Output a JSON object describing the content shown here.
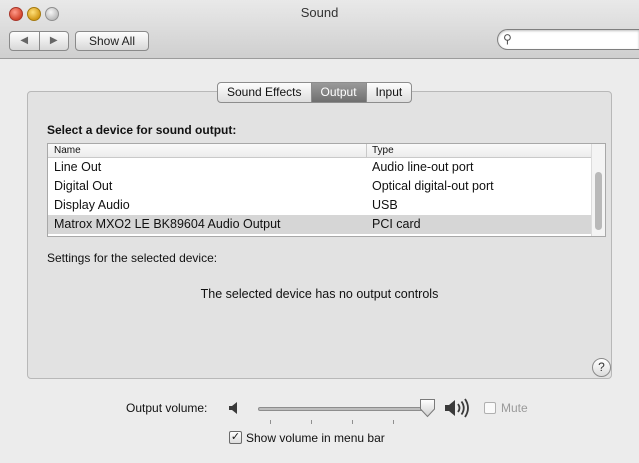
{
  "window": {
    "title": "Sound"
  },
  "toolbar": {
    "back_icon": "triangle-left-icon",
    "forward_icon": "triangle-right-icon",
    "show_all_label": "Show All",
    "search_value": "",
    "search_icon": "magnifier-icon"
  },
  "tabs": [
    {
      "label": "Sound Effects",
      "active": false
    },
    {
      "label": "Output",
      "active": true
    },
    {
      "label": "Input",
      "active": false
    }
  ],
  "output": {
    "section_title": "Select a device for sound output:",
    "columns": {
      "name": "Name",
      "type": "Type"
    },
    "devices": [
      {
        "name": "Line Out",
        "type": "Audio line-out port",
        "selected": false
      },
      {
        "name": "Digital Out",
        "type": "Optical digital-out port",
        "selected": false
      },
      {
        "name": "Display Audio",
        "type": "USB",
        "selected": false
      },
      {
        "name": "Matrox MXO2 LE BK89604 Audio Output",
        "type": "PCI card",
        "selected": true
      }
    ],
    "settings_label": "Settings for the selected device:",
    "no_controls_text": "The selected device has no output controls",
    "help_label": "?"
  },
  "volume": {
    "label": "Output volume:",
    "level": 1.0,
    "low_icon": "speaker-low-icon",
    "high_icon": "speaker-high-icon",
    "mute_label": "Mute",
    "mute_checked": false
  },
  "menu_bar_option": {
    "label": "Show volume in menu bar",
    "checked": true
  },
  "colors": {
    "selected_row": "#d6d6d6",
    "active_tab": "#7f7f7f"
  }
}
